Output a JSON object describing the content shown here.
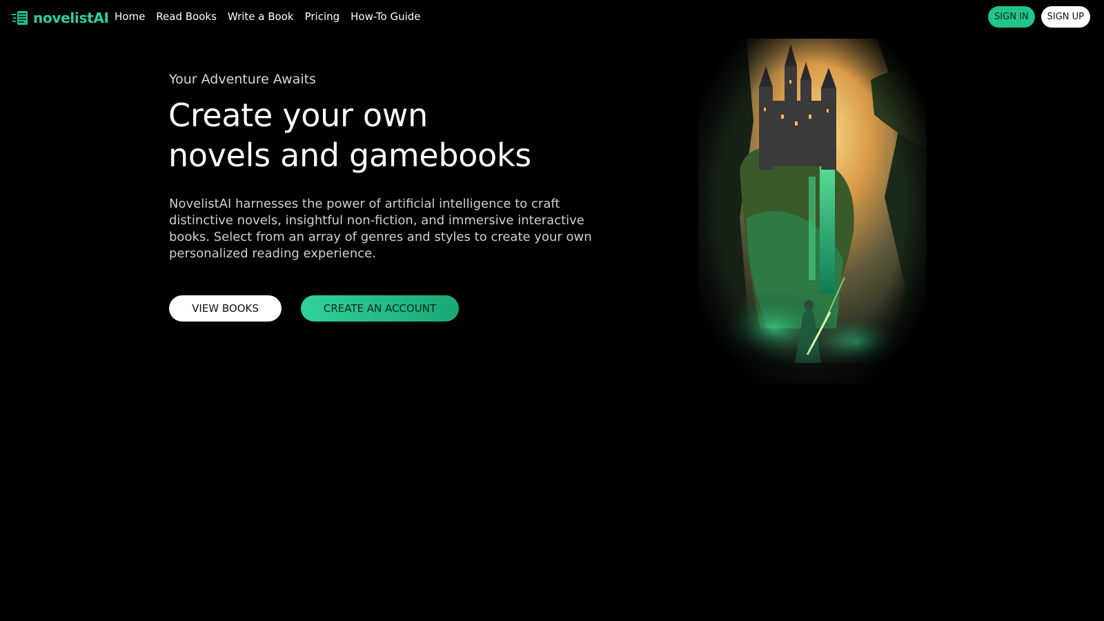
{
  "brand": {
    "name": "novelistAI",
    "logo_icon": "book-pages-icon",
    "accent_color": "#22c48c"
  },
  "nav": {
    "items": [
      {
        "label": "Home"
      },
      {
        "label": "Read Books"
      },
      {
        "label": "Write a Book"
      },
      {
        "label": "Pricing"
      },
      {
        "label": "How-To Guide"
      }
    ]
  },
  "auth": {
    "sign_in_label": "SIGN IN",
    "sign_up_label": "SIGN UP"
  },
  "hero": {
    "eyebrow": "Your Adventure Awaits",
    "title_line1": "Create your own",
    "title_line2": "novels and gamebooks",
    "description": "NovelistAI harnesses the power of artificial intelligence to craft distinctive novels, insightful non-fiction, and immersive interactive books. Select from an array of genres and styles to create your own personalized reading experience.",
    "view_books_label": "VIEW BOOKS",
    "create_account_label": "CREATE AN ACCOUNT",
    "illustration": "fantasy-castle-cliff-knight-image"
  }
}
